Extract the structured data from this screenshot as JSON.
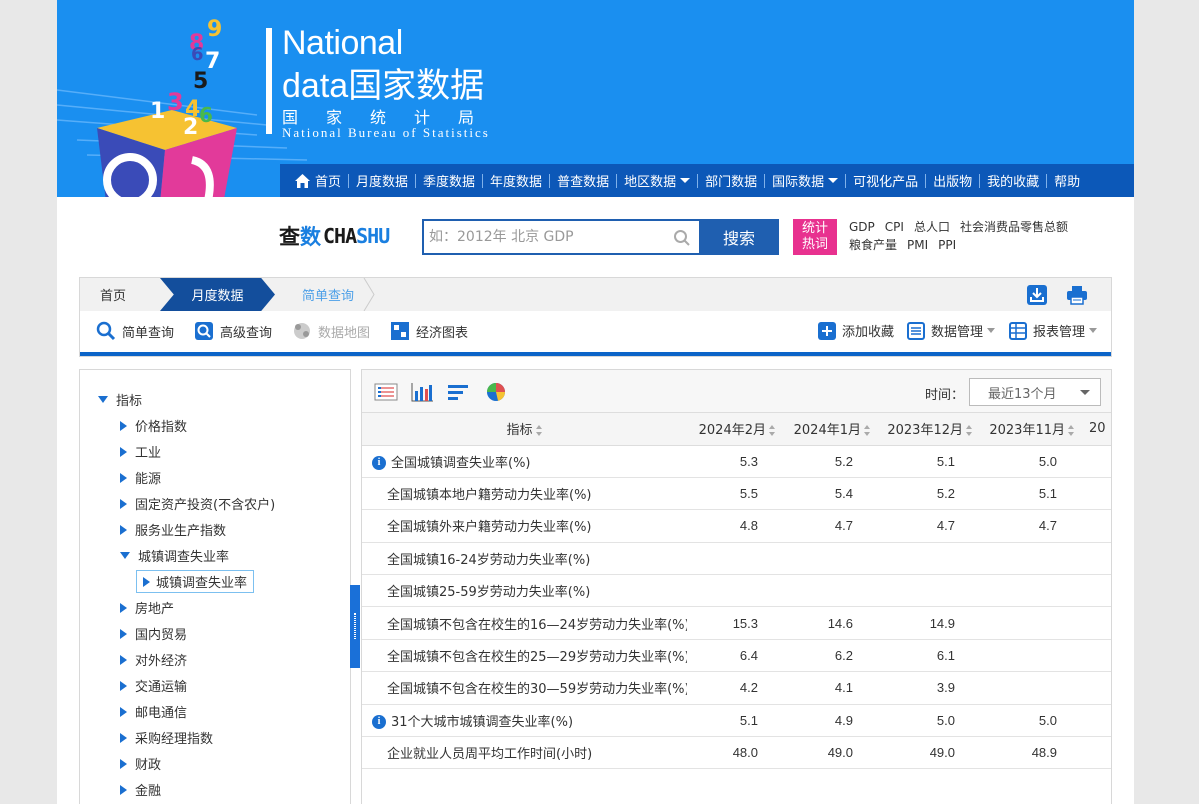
{
  "brand": {
    "en_line1": "National",
    "en_line2": "data",
    "cn_line2": "国家数据",
    "cn_bureau": "国家统计局",
    "en_bureau": "National Bureau of Statistics",
    "cube_digits": [
      "9",
      "8",
      "7",
      "6",
      "5",
      "1",
      "3",
      "4",
      "6",
      "2"
    ]
  },
  "topnav": {
    "items": [
      {
        "label": "首页",
        "icon": "home-icon"
      },
      {
        "label": "月度数据"
      },
      {
        "label": "季度数据"
      },
      {
        "label": "年度数据"
      },
      {
        "label": "普查数据"
      },
      {
        "label": "地区数据",
        "dropdown": true
      },
      {
        "label": "部门数据"
      },
      {
        "label": "国际数据",
        "dropdown": true
      },
      {
        "label": "可视化产品"
      },
      {
        "label": "出版物"
      },
      {
        "label": "我的收藏"
      },
      {
        "label": "帮助"
      }
    ]
  },
  "search": {
    "logo_cn_1": "查",
    "logo_cn_2": "数",
    "logo_en_1": "CHA",
    "logo_en_2": "SHU",
    "placeholder": "如：2012年 北京 GDP",
    "button_label": "搜索",
    "hot_tag_line1": "统计",
    "hot_tag_line2": "热词",
    "hot_words": [
      "GDP",
      "CPI",
      "总人口",
      "社会消费品零售总额",
      "粮食产量",
      "PMI",
      "PPI"
    ]
  },
  "breadcrumb": {
    "home": "首页",
    "month": "月度数据",
    "current": "简单查询"
  },
  "toolbar": {
    "simple_query": "简单查询",
    "advanced_query": "高级查询",
    "data_map": "数据地图",
    "econ_chart": "经济图表",
    "add_favorite": "添加收藏",
    "data_manage": "数据管理",
    "report_manage": "报表管理"
  },
  "tree": {
    "root": "指标",
    "items": [
      {
        "label": "价格指数",
        "expanded": false
      },
      {
        "label": "工业",
        "expanded": false
      },
      {
        "label": "能源",
        "expanded": false
      },
      {
        "label": "固定资产投资(不含农户)",
        "expanded": false
      },
      {
        "label": "服务业生产指数",
        "expanded": false
      },
      {
        "label": "城镇调查失业率",
        "expanded": true
      },
      {
        "label": "房地产",
        "expanded": false
      },
      {
        "label": "国内贸易",
        "expanded": false
      },
      {
        "label": "对外经济",
        "expanded": false
      },
      {
        "label": "交通运输",
        "expanded": false
      },
      {
        "label": "邮电通信",
        "expanded": false
      },
      {
        "label": "采购经理指数",
        "expanded": false
      },
      {
        "label": "财政",
        "expanded": false
      },
      {
        "label": "金融",
        "expanded": false
      }
    ],
    "selected_child": "城镇调查失业率"
  },
  "data_panel": {
    "time_label": "时间：",
    "time_value": "最近13个月",
    "header_indicator": "指标",
    "columns": [
      "2024年2月",
      "2024年1月",
      "2023年12月",
      "2023年11月",
      "20"
    ],
    "rows": [
      {
        "name": "全国城镇调查失业率(%)",
        "info": true,
        "values": [
          "5.3",
          "5.2",
          "5.1",
          "5.0"
        ]
      },
      {
        "name": "全国城镇本地户籍劳动力失业率(%)",
        "info": false,
        "values": [
          "5.5",
          "5.4",
          "5.2",
          "5.1"
        ]
      },
      {
        "name": "全国城镇外来户籍劳动力失业率(%)",
        "info": false,
        "values": [
          "4.8",
          "4.7",
          "4.7",
          "4.7"
        ]
      },
      {
        "name": "全国城镇16-24岁劳动力失业率(%)",
        "info": false,
        "values": [
          "",
          "",
          "",
          ""
        ]
      },
      {
        "name": "全国城镇25-59岁劳动力失业率(%)",
        "info": false,
        "values": [
          "",
          "",
          "",
          ""
        ]
      },
      {
        "name": "全国城镇不包含在校生的16—24岁劳动力失业率(%)",
        "info": false,
        "values": [
          "15.3",
          "14.6",
          "14.9",
          ""
        ]
      },
      {
        "name": "全国城镇不包含在校生的25—29岁劳动力失业率(%)",
        "info": false,
        "values": [
          "6.4",
          "6.2",
          "6.1",
          ""
        ]
      },
      {
        "name": "全国城镇不包含在校生的30—59岁劳动力失业率(%)",
        "info": false,
        "values": [
          "4.2",
          "4.1",
          "3.9",
          ""
        ]
      },
      {
        "name": "31个大城市城镇调查失业率(%)",
        "info": true,
        "values": [
          "5.1",
          "4.9",
          "5.0",
          "5.0"
        ]
      },
      {
        "name": "企业就业人员周平均工作时间(小时)",
        "info": false,
        "values": [
          "48.0",
          "49.0",
          "49.0",
          "48.9"
        ]
      }
    ]
  },
  "colors": {
    "banner": "#1a8ff0",
    "nav": "#0c58b8",
    "accent": "#1a6fd0",
    "hot_tag": "#e8318f"
  }
}
